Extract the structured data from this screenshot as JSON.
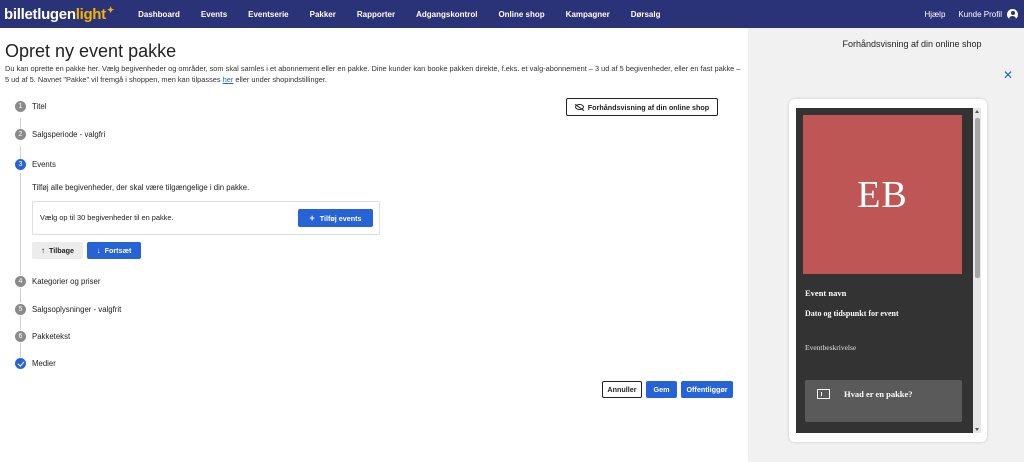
{
  "brand": {
    "name_part1": "billetlugen",
    "name_part2": "light",
    "star": "✦"
  },
  "nav": {
    "items": [
      "Dashboard",
      "Events",
      "Eventserie",
      "Pakker",
      "Rapporter",
      "Adgangskontrol",
      "Online shop",
      "Kampagner",
      "Dørsalg"
    ],
    "help": "Hjælp",
    "profile": "Kunde Profil"
  },
  "page": {
    "title": "Opret ny event pakke",
    "intro_before_link": "Du kan oprette en pakke her. Vælg begivenheder og områder, som skal samles i et abonnement eller en pakke. Dine kunder kan booke pakken direkte, f.eks. et valg-abonnement – 3 ud af 5 begivenheder, eller en fast pakke – 5 ud af 5. Navnet \"Pakke\" vil fremgå i shoppen, men kan tilpasses ",
    "intro_link": "her",
    "intro_after_link": " eller under shopindstillinger.",
    "preview_button": "Forhåndsvisning af din online shop"
  },
  "steps": [
    {
      "num": "1",
      "label": "Titel"
    },
    {
      "num": "2",
      "label": "Salgsperiode - valgfri"
    },
    {
      "num": "3",
      "label": "Events"
    },
    {
      "num": "4",
      "label": "Kategorier og priser"
    },
    {
      "num": "5",
      "label": "Salgsoplysninger - valgfrit"
    },
    {
      "num": "6",
      "label": "Pakketekst"
    },
    {
      "num": "",
      "label": "Medier"
    }
  ],
  "events_step": {
    "description": "Tilføj alle begivenheder, der skal være tilgængelige i din pakke.",
    "hint": "Vælg op til 30 begivenheder til en pakke.",
    "add_button": "Tilføj events",
    "back_button": "Tilbage",
    "continue_button": "Fortsæt"
  },
  "actions": {
    "cancel": "Annuller",
    "save": "Gem",
    "publish": "Offentliggør"
  },
  "preview": {
    "title": "Forhåndsvisning af din online shop",
    "initials": "EB",
    "event_name": "Event navn",
    "event_date": "Dato og tidspunkt for event",
    "event_description": "Eventbeskrivelse",
    "package_card_title": "Hvad er en pakke?",
    "hero_color": "#bf5656"
  },
  "colors": {
    "nav_bg": "#2a3278",
    "accent": "#2563d6",
    "logo_accent": "#f5b400"
  }
}
